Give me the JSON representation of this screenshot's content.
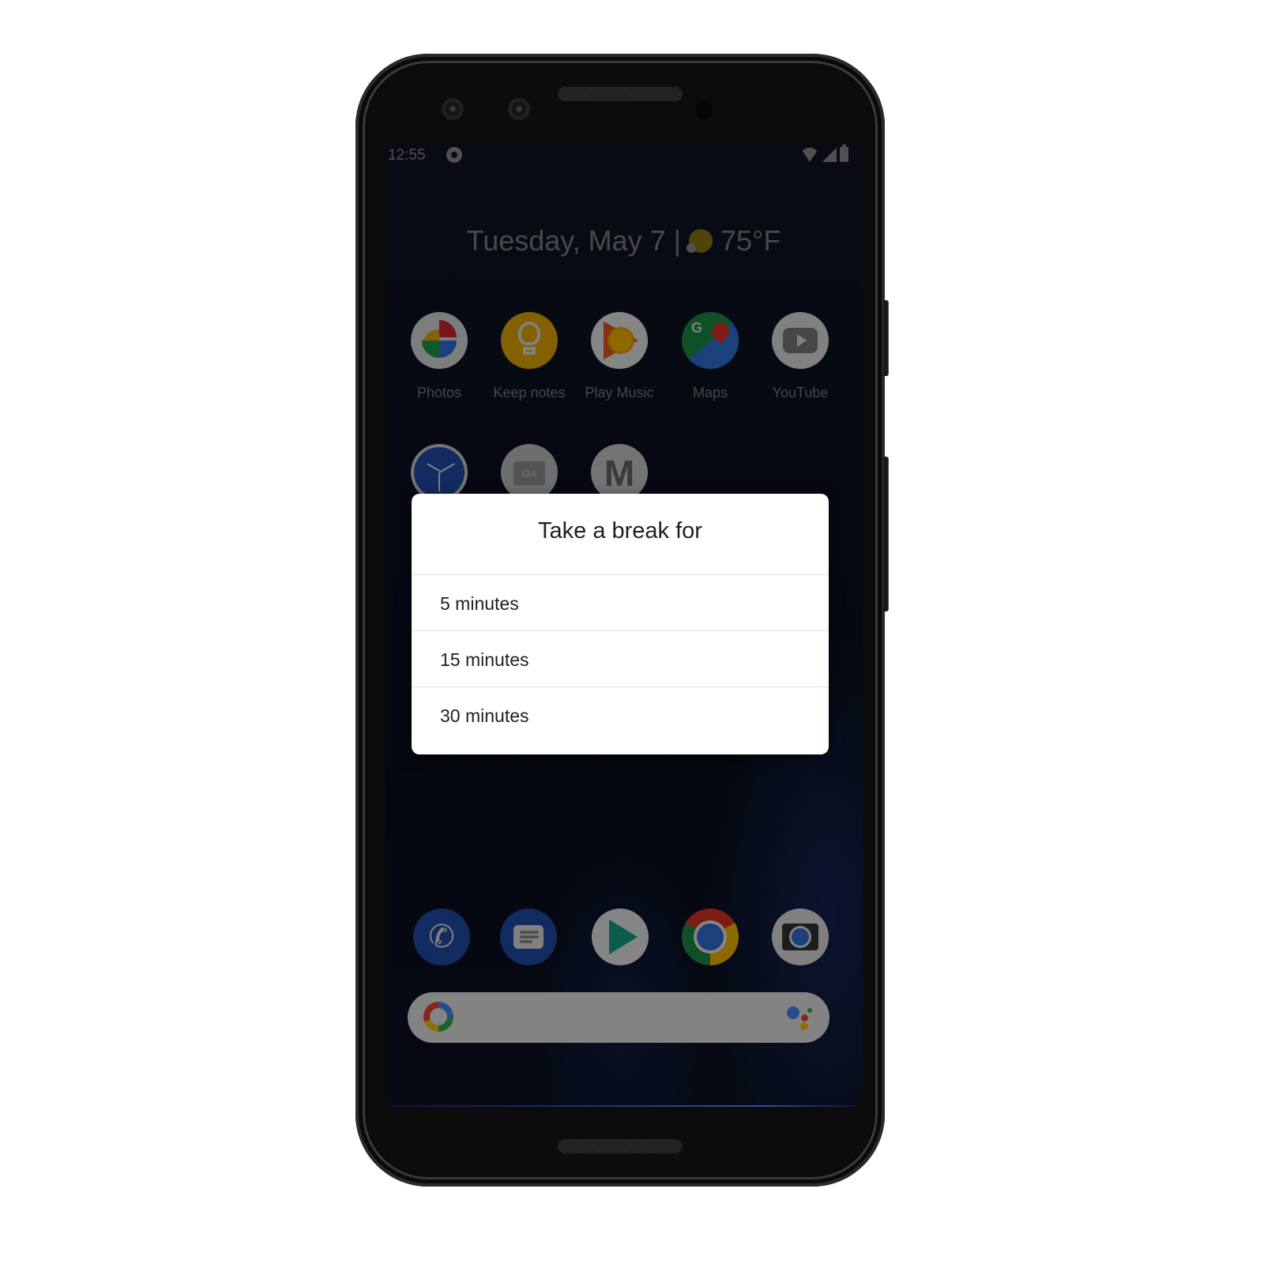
{
  "status_bar": {
    "time": "12:55",
    "icons": [
      "do-not-disturb-icon",
      "wifi-icon",
      "signal-icon",
      "battery-icon"
    ]
  },
  "glance": {
    "date": "Tuesday, May 7",
    "separator": "|",
    "weather_icon": "partly-sunny-icon",
    "temperature": "75°F"
  },
  "home_apps": [
    {
      "label": "Photos",
      "icon": "photos-icon"
    },
    {
      "label": "Keep notes",
      "icon": "keep-notes-icon"
    },
    {
      "label": "Play Music",
      "icon": "play-music-icon"
    },
    {
      "label": "Maps",
      "icon": "maps-icon"
    },
    {
      "label": "YouTube",
      "icon": "youtube-icon"
    }
  ],
  "second_row_apps": [
    {
      "icon": "clock-icon"
    },
    {
      "icon": "google-news-icon",
      "glyph": "G≡"
    },
    {
      "icon": "gmail-icon",
      "glyph": "M"
    }
  ],
  "dock_apps": [
    {
      "icon": "phone-icon",
      "glyph": "✆"
    },
    {
      "icon": "messages-icon"
    },
    {
      "icon": "play-store-icon"
    },
    {
      "icon": "chrome-icon"
    },
    {
      "icon": "camera-icon"
    }
  ],
  "search_bar": {
    "logo": "google-g-icon",
    "assistant": "google-assistant-icon"
  },
  "dialog": {
    "title": "Take a break for",
    "options": [
      "5 minutes",
      "15 minutes",
      "30 minutes"
    ]
  }
}
